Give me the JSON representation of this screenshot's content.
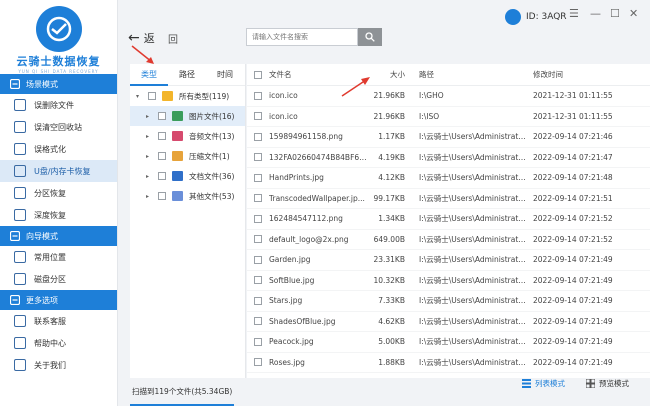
{
  "app": {
    "logo_text": "云骑士数据恢复",
    "logo_sub": "YUN QI SHI DATA RECOVERY",
    "user_id": "ID: 3AQR",
    "win_controls": [
      "☰",
      "—",
      "☐",
      "✕"
    ]
  },
  "sidebar": {
    "sections": [
      {
        "title": "场景模式",
        "items": [
          {
            "label": "误删除文件",
            "active": false
          },
          {
            "label": "误清空回收站",
            "active": false
          },
          {
            "label": "误格式化",
            "active": false
          },
          {
            "label": "U盘/内存卡恢复",
            "active": true
          },
          {
            "label": "分区恢复",
            "active": false
          },
          {
            "label": "深度恢复",
            "active": false
          }
        ]
      },
      {
        "title": "向导模式",
        "items": [
          {
            "label": "常用位置",
            "active": false
          },
          {
            "label": "磁盘分区",
            "active": false
          }
        ]
      },
      {
        "title": "更多选项",
        "items": [
          {
            "label": "联系客服",
            "active": false
          },
          {
            "label": "帮助中心",
            "active": false
          },
          {
            "label": "关于我们",
            "active": false
          }
        ]
      }
    ]
  },
  "toolbar": {
    "back_label": "返",
    "refresh_label": "回",
    "search_placeholder": "请输入文件名搜索"
  },
  "tree": {
    "tabs": [
      "类型",
      "路径",
      "时间"
    ],
    "active_tab": 0,
    "rows": [
      {
        "label": "所有类型(119)",
        "icon": "folder-icon",
        "color": "#f3b52b",
        "level": 0,
        "selected": false,
        "expandable": true
      },
      {
        "label": "图片文件(16)",
        "icon": "image-icon",
        "color": "#3a9d5c",
        "level": 1,
        "selected": true,
        "expandable": true
      },
      {
        "label": "音频文件(13)",
        "icon": "audio-icon",
        "color": "#d64a6e",
        "level": 1,
        "selected": false,
        "expandable": true
      },
      {
        "label": "压缩文件(1)",
        "icon": "archive-icon",
        "color": "#e7a33a",
        "level": 1,
        "selected": false,
        "expandable": true
      },
      {
        "label": "文档文件(36)",
        "icon": "document-icon",
        "color": "#2f6fc9",
        "level": 1,
        "selected": false,
        "expandable": true
      },
      {
        "label": "其他文件(53)",
        "icon": "other-files-icon",
        "color": "#6a8fd9",
        "level": 1,
        "selected": false,
        "expandable": true
      }
    ]
  },
  "file_list": {
    "headers": {
      "name": "文件名",
      "size": "大小",
      "path": "路径",
      "time": "修改时间"
    },
    "rows": [
      {
        "name": "icon.ico",
        "size": "21.96KB",
        "path": "I:\\GHO",
        "time": "2021-12-31 01:11:55"
      },
      {
        "name": "icon.ico",
        "size": "21.96KB",
        "path": "I:\\ISO",
        "time": "2021-12-31 01:11:55"
      },
      {
        "name": "159894961158.png",
        "size": "1.17KB",
        "path": "I:\\云骑士\\Users\\Administrator\\Ap...",
        "time": "2022-09-14 07:21:46"
      },
      {
        "name": "132FA02660474B84BF67...",
        "size": "4.19KB",
        "path": "I:\\云骑士\\Users\\Administrator\\Ap...",
        "time": "2022-09-14 07:21:47"
      },
      {
        "name": "HandPrints.jpg",
        "size": "4.12KB",
        "path": "I:\\云骑士\\Users\\Administrator\\Ap...",
        "time": "2022-09-14 07:21:48"
      },
      {
        "name": "TranscodedWallpaper.jp...",
        "size": "99.17KB",
        "path": "I:\\云骑士\\Users\\Administrator\\Ap...",
        "time": "2022-09-14 07:21:51"
      },
      {
        "name": "162484547112.png",
        "size": "1.34KB",
        "path": "I:\\云骑士\\Users\\Administrator\\Ap...",
        "time": "2022-09-14 07:21:52"
      },
      {
        "name": "default_logo@2x.png",
        "size": "649.00B",
        "path": "I:\\云骑士\\Users\\Administrator\\Ap...",
        "time": "2022-09-14 07:21:52"
      },
      {
        "name": "Garden.jpg",
        "size": "23.31KB",
        "path": "I:\\云骑士\\Users\\Administrator\\Ap...",
        "time": "2022-09-14 07:21:49"
      },
      {
        "name": "SoftBlue.jpg",
        "size": "10.32KB",
        "path": "I:\\云骑士\\Users\\Administrator\\Ap...",
        "time": "2022-09-14 07:21:49"
      },
      {
        "name": "Stars.jpg",
        "size": "7.33KB",
        "path": "I:\\云骑士\\Users\\Administrator\\Ap...",
        "time": "2022-09-14 07:21:49"
      },
      {
        "name": "ShadesOfBlue.jpg",
        "size": "4.62KB",
        "path": "I:\\云骑士\\Users\\Administrator\\Ap...",
        "time": "2022-09-14 07:21:49"
      },
      {
        "name": "Peacock.jpg",
        "size": "5.00KB",
        "path": "I:\\云骑士\\Users\\Administrator\\Ap...",
        "time": "2022-09-14 07:21:49"
      },
      {
        "name": "Roses.jpg",
        "size": "1.88KB",
        "path": "I:\\云骑士\\Users\\Administrator\\Ap...",
        "time": "2022-09-14 07:21:49"
      }
    ]
  },
  "status": {
    "scan_text": "扫描到119个文件(共5.34GB)",
    "list_mode": "列表模式",
    "preview_mode": "预览模式"
  },
  "colors": {
    "accent": "#1e7fd8",
    "annotation_arrow": "#e03a2f"
  }
}
